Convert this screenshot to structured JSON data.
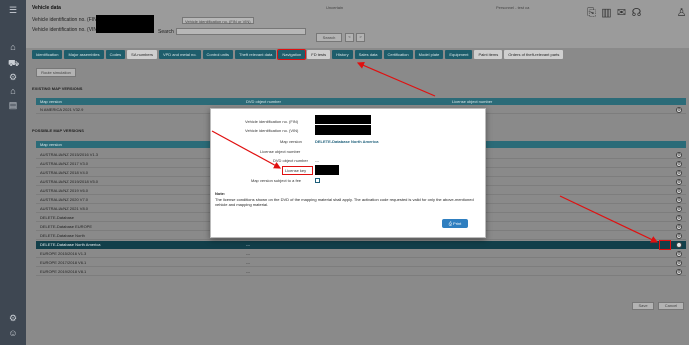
{
  "header": {
    "title": "Vehicle data",
    "center_label": "Uncertain",
    "right_label": "Personnel - test ca",
    "fin_label": "Vehicle identification no. (FIN)",
    "vin_label": "Vehicle identification no. (VIN)",
    "select_value": "Vehicle identification no. (FIN or VIN)",
    "search_label": "Search",
    "search_button": "Search",
    "prev": "<",
    "next": ">"
  },
  "tabs": [
    "Identification",
    "Major assemblies",
    "Codes",
    "SA numbers",
    "VPD and metal no.",
    "Control units",
    "Theft relevant data",
    "Navigation",
    "FD tests",
    "History",
    "Sales data",
    "Certification",
    "Model plate",
    "Equipment",
    "Paint items",
    "Orders of theft-relevant parts"
  ],
  "main": {
    "route_button": "Route simulation",
    "existing_heading": "EXISTING MAP VERSIONS",
    "possible_heading": "POSSIBLE MAP VERSIONS",
    "cols": [
      "Map version",
      "DVD object number",
      "License object number",
      "Other"
    ],
    "existing_rows": [
      "N AMERICA 2021 V32.9"
    ],
    "dash": "---",
    "rows": [
      "AUSTRALIA/NZ 2015/2016 V1.3",
      "AUSTRALIA/NZ 2017 V3.0",
      "AUSTRALIA/NZ 2018 V4.0",
      "AUSTRALIA/NZ 2019/2018 V5.0",
      "AUSTRALIA/NZ 2019 V6.0",
      "AUSTRALIA/NZ 2020 V7.0",
      "AUSTRALIA/NZ 2021 V8.0",
      "DELETE-Database",
      "DELETE-Database EUROPE",
      "DELETE-Database North",
      "DELETE-Database North America",
      "EUROPE 2015/2016 V1.3",
      "EUROPE 2017/2018 V6.1",
      "EUROPE 2019/2018 V8.1"
    ]
  },
  "modal": {
    "fin_label": "Vehicle identification no. (FIN)",
    "vin_label": "Vehicle identification no. (VIN)",
    "map_version_label": "Map version",
    "map_version_value": "DELETE-Database North America",
    "license_object_label": "License object number",
    "dvd_object_label": "DVD object number",
    "dvd_object_value": "---",
    "license_key_label": "License key",
    "subject_fee_label": "Map version subject to a fee",
    "note_heading": "Note:",
    "note_text": "The license conditions shown on the DVD of the mapping material shall apply. The activation code requested is valid for only the above-mentioned vehicle and mapping material.",
    "print_label": "Print"
  },
  "footer": {
    "save": "Save",
    "cancel": "Cancel"
  },
  "colors": {
    "accent": "#1e5d6b",
    "selected_row": "#123f4a",
    "annotation": "#e01010",
    "print_button": "#2f7fc0"
  }
}
